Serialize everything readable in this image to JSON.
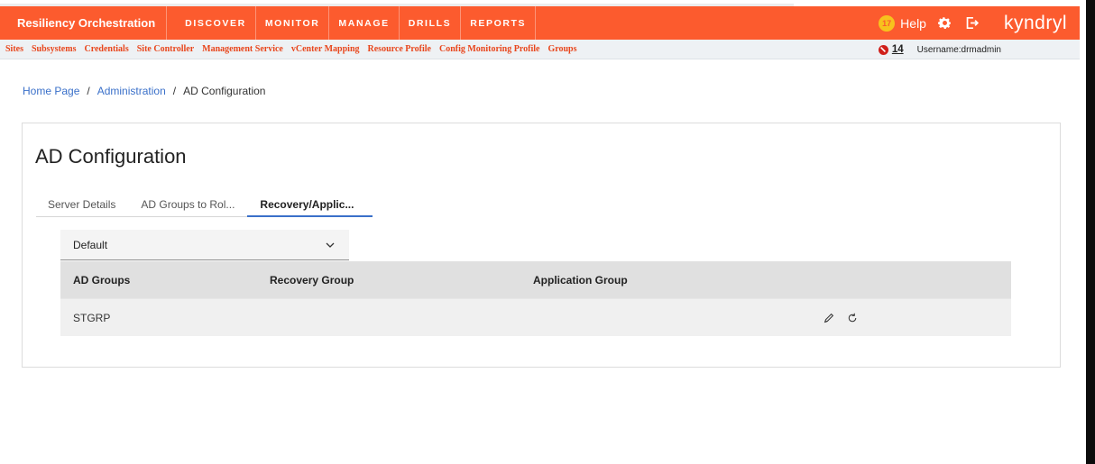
{
  "header": {
    "brand": "Resiliency Orchestration",
    "nav": [
      "DISCOVER",
      "MONITOR",
      "MANAGE",
      "DRILLS",
      "REPORTS"
    ],
    "notification_count": "17",
    "help_label": "Help",
    "logo": "kyndryl"
  },
  "subnav": {
    "items": [
      "Sites",
      "Subsystems",
      "Credentials",
      "Site Controller",
      "Management Service",
      "vCenter Mapping",
      "Resource Profile",
      "Config Monitoring Profile",
      "Groups"
    ],
    "alert_count": "14",
    "username": "Username:drmadmin"
  },
  "breadcrumb": {
    "home": "Home Page",
    "admin": "Administration",
    "current": "AD Configuration"
  },
  "page": {
    "title": "AD Configuration",
    "tabs": [
      "Server Details",
      "AD Groups to Rol...",
      "Recovery/Applic..."
    ],
    "active_tab": 2,
    "dropdown_value": "Default"
  },
  "table": {
    "columns": [
      "AD Groups",
      "Recovery Group",
      "Application Group"
    ],
    "rows": [
      {
        "ad_group": "STGRP",
        "recovery_group": "",
        "application_group": ""
      }
    ]
  },
  "icons": {
    "notification": "lightbulb-icon",
    "settings": "gear-icon",
    "logout": "logout-icon",
    "alert": "alert-icon",
    "dropdown": "chevron-down-icon",
    "edit": "edit-icon",
    "reset": "refresh-icon"
  },
  "colors": {
    "header_bg": "#fc5b2e",
    "subnav_link": "#e8461c",
    "link": "#3a70c9",
    "badge": "#f7c21d"
  }
}
